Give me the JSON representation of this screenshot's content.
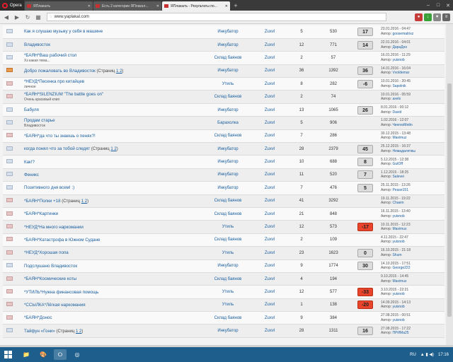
{
  "browser": {
    "menu_label": "Opera",
    "tabs": [
      {
        "label": "ЯПлакалъ",
        "active": false
      },
      {
        "label": "Есть 2 категории ЯПлакал...",
        "active": false
      },
      {
        "label": "ЯПлакалъ - Результаты по...",
        "active": true
      }
    ],
    "new_tab": "+",
    "url": "www.yaplakal.com"
  },
  "topics": [
    {
      "icon": "normal",
      "title": "Как я слушаю музыку у себя в машине",
      "pages": "",
      "subtitle": "",
      "forum": "Инкубатор",
      "author": "Zuxvl",
      "replies": "5",
      "views": "530",
      "rating": "17",
      "rating_type": "pos",
      "last_date": "23.01.2016 - 04:47",
      "last_author_prefix": "Автор:",
      "last_author": "goosematrixz"
    },
    {
      "icon": "normal",
      "title": "Владивосток",
      "pages": "",
      "subtitle": "",
      "forum": "Инкубатор",
      "author": "Zuxvl",
      "replies": "12",
      "views": "771",
      "rating": "14",
      "rating_type": "pos",
      "last_date": "22.01.2016 - 04:01",
      "last_author_prefix": "Автор:",
      "last_author": "ДараДно"
    },
    {
      "icon": "normal",
      "title": "*БАЯН*Ваш рабочий стол",
      "pages": "",
      "subtitle": "Хз какая тема...",
      "forum": "Склад баянов",
      "author": "Zuxvl",
      "replies": "2",
      "views": "57",
      "rating": "",
      "rating_type": "none",
      "last_date": "16.01.2016 - 11:29",
      "last_author_prefix": "Автор:",
      "last_author": "yuisnob"
    },
    {
      "icon": "hot",
      "title": "Добро пожаловать во Владивосток",
      "pages": "1 2",
      "subtitle": "",
      "forum": "Инкубатор",
      "author": "Zuxvl",
      "replies": "36",
      "views": "1392",
      "rating": "36",
      "rating_type": "pos",
      "last_date": "14.01.2016 - 16:04",
      "last_author_prefix": "Автор:",
      "last_author": "Vvoldemar"
    },
    {
      "icon": "red",
      "title": "*НЕУД*Песенка про китайцев",
      "pages": "",
      "subtitle": "личное",
      "forum": "Утиль",
      "author": "Zuxvl",
      "replies": "8",
      "views": "282",
      "rating": "-6",
      "rating_type": "pos",
      "last_date": "10.01.2016 - 20:45",
      "last_author_prefix": "Автор:",
      "last_author": "Sapolnik"
    },
    {
      "icon": "red",
      "title": "*БАЯН*SILENZIUM \"The battle goes on\"",
      "pages": "",
      "subtitle": "Очень красивый клип",
      "forum": "Склад баянов",
      "author": "Zuxvl",
      "replies": "2",
      "views": "74",
      "rating": "",
      "rating_type": "none",
      "last_date": "10.01.2016 - 05:59",
      "last_author_prefix": "Автор:",
      "last_author": "axels"
    },
    {
      "icon": "normal",
      "title": "Бабуля",
      "pages": "",
      "subtitle": "",
      "forum": "Инкубатор",
      "author": "Zuxvl",
      "replies": "13",
      "views": "1065",
      "rating": "26",
      "rating_type": "pos",
      "last_date": "8.01.2016 - 00:12",
      "last_author_prefix": "Автор:",
      "last_author": "David"
    },
    {
      "icon": "normal",
      "title": "Продам старье",
      "pages": "",
      "subtitle": "Владивосток",
      "forum": "Барахолка",
      "author": "Zuxvl",
      "replies": "5",
      "views": "906",
      "rating": "",
      "rating_type": "none",
      "last_date": "1.02.2016 - 12:07",
      "last_author_prefix": "Автор:",
      "last_author": "ЧингизМейо"
    },
    {
      "icon": "red",
      "title": "*БАЯН*да что ты знаешь о пенях?!",
      "pages": "",
      "subtitle": "",
      "forum": "Склад баянов",
      "author": "Zuxvl",
      "replies": "7",
      "views": "286",
      "rating": "",
      "rating_type": "none",
      "last_date": "30.12.2015 - 13:48",
      "last_author_prefix": "Автор:",
      "last_author": "Maximuz"
    },
    {
      "icon": "normal",
      "title": "когда понял что за тобой следят",
      "pages": "1 2",
      "subtitle": "",
      "forum": "Инкубатор",
      "author": "Zuxvl",
      "replies": "28",
      "views": "2379",
      "rating": "45",
      "rating_type": "pos",
      "last_date": "25.12.2015 - 16:37",
      "last_author_prefix": "Автор:",
      "last_author": "Немадалятвы"
    },
    {
      "icon": "normal",
      "title": "Как!?",
      "pages": "",
      "subtitle": "",
      "forum": "Инкубатор",
      "author": "Zuxvl",
      "replies": "10",
      "views": "688",
      "rating": "8",
      "rating_type": "pos",
      "last_date": "5.12.2015 - 12:38",
      "last_author_prefix": "Автор:",
      "last_author": "GutOff"
    },
    {
      "icon": "normal",
      "title": "Феникс",
      "pages": "",
      "subtitle": "",
      "forum": "Инкубатор",
      "author": "Zuxvl",
      "replies": "11",
      "views": "520",
      "rating": "7",
      "rating_type": "pos",
      "last_date": "1.12.2015 - 18:25",
      "last_author_prefix": "Автор:",
      "last_author": "Salevei"
    },
    {
      "icon": "normal",
      "title": "Позитивного дня всем! :)",
      "pages": "",
      "subtitle": "",
      "forum": "Инкубатор",
      "author": "Zuxvl",
      "replies": "7",
      "views": "476",
      "rating": "5",
      "rating_type": "pos",
      "last_date": "25.11.2015 - 13:26",
      "last_author_prefix": "Автор:",
      "last_author": "Pease151"
    },
    {
      "icon": "red",
      "title": "*БАЯН*Полки +18",
      "pages": "1 2",
      "subtitle": "",
      "forum": "Склад баянов",
      "author": "Zuxvl",
      "replies": "41",
      "views": "3292",
      "rating": "",
      "rating_type": "none",
      "last_date": "19.11.2015 - 19:22",
      "last_author_prefix": "Автор:",
      "last_author": "Chaem"
    },
    {
      "icon": "red",
      "title": "*БАЯН*Картинки",
      "pages": "",
      "subtitle": "",
      "forum": "Склад баянов",
      "author": "Zuxvl",
      "replies": "21",
      "views": "848",
      "rating": "",
      "rating_type": "none",
      "last_date": "16.11.2015 - 13:40",
      "last_author_prefix": "Автор:",
      "last_author": "yuisnob"
    },
    {
      "icon": "red",
      "title": "*НЕУД*На много наркомании",
      "pages": "",
      "subtitle": "",
      "forum": "Утиль",
      "author": "Zuxvl",
      "replies": "12",
      "views": "573",
      "rating": "-17",
      "rating_type": "neg",
      "last_date": "10.11.2015 - 12:23",
      "last_author_prefix": "Автор:",
      "last_author": "Maximus"
    },
    {
      "icon": "red",
      "title": "*БАЯН*Катастрофа в Южном Судане",
      "pages": "",
      "subtitle": "",
      "forum": "Склад баянов",
      "author": "Zuxvl",
      "replies": "2",
      "views": "109",
      "rating": "",
      "rating_type": "none",
      "last_date": "4.11.2015 - 22:47",
      "last_author_prefix": "Автор:",
      "last_author": "yuisnob"
    },
    {
      "icon": "red",
      "title": "*НЕУД*Хорошая попа",
      "pages": "",
      "subtitle": "",
      "forum": "Утиль",
      "author": "Zuxvl",
      "replies": "23",
      "views": "1623",
      "rating": "0",
      "rating_type": "pos",
      "last_date": "16.10.2015 - 21:18",
      "last_author_prefix": "Автор:",
      "last_author": "Shum"
    },
    {
      "icon": "normal",
      "title": "Подслушано Владивосток",
      "pages": "",
      "subtitle": "",
      "forum": "Инкубатор",
      "author": "Zuxvl",
      "replies": "9",
      "views": "1774",
      "rating": "30",
      "rating_type": "pos",
      "last_date": "14.10.2015 - 17:51",
      "last_author_prefix": "Автор:",
      "last_author": "George222"
    },
    {
      "icon": "red",
      "title": "*БАЯН*Космические коты",
      "pages": "",
      "subtitle": "",
      "forum": "Склад баянов",
      "author": "Zuxvl",
      "replies": "4",
      "views": "194",
      "rating": "",
      "rating_type": "none",
      "last_date": "9.10.2015 - 14:45",
      "last_author_prefix": "Автор:",
      "last_author": "Maximuz"
    },
    {
      "icon": "red",
      "title": "*УТИЛЬ*Нужна финансовая помощь",
      "pages": "",
      "subtitle": "",
      "forum": "Утиль",
      "author": "Zuxvl",
      "replies": "12",
      "views": "577",
      "rating": "-33",
      "rating_type": "neg",
      "last_date": "3.10.2015 - 22:21",
      "last_author_prefix": "Автор:",
      "last_author": "yuisnob"
    },
    {
      "icon": "red",
      "title": "*ССЫЛКА*Лёгкая наркомания",
      "pages": "",
      "subtitle": "",
      "forum": "Утиль",
      "author": "Zuxvl",
      "replies": "1",
      "views": "138",
      "rating": "-20",
      "rating_type": "neg",
      "last_date": "14.09.2015 - 14:13",
      "last_author_prefix": "Автор:",
      "last_author": "yuisnob"
    },
    {
      "icon": "red",
      "title": "*БАЯН*Донос",
      "pages": "",
      "subtitle": "",
      "forum": "Склад баянов",
      "author": "Zuxvl",
      "replies": "9",
      "views": "384",
      "rating": "",
      "rating_type": "none",
      "last_date": "27.08.2015 - 00:51",
      "last_author_prefix": "Автор:",
      "last_author": "yuisnob"
    },
    {
      "icon": "normal",
      "title": "Тайфун «Гони»",
      "pages": "1 2",
      "subtitle": "",
      "forum": "Инкубатор",
      "author": "Zuxvl",
      "replies": "28",
      "views": "1311",
      "rating": "16",
      "rating_type": "pos",
      "last_date": "27.08.2015 - 17:22",
      "last_author_prefix": "Автор:",
      "last_author": "ПРИМа25"
    }
  ],
  "pages_prefix": "(Страниц",
  "pages_suffix": ")",
  "taskbar": {
    "lang": "RU",
    "time": "17:16"
  },
  "colors": {
    "link": "#1a5fa0",
    "negative_rating": "#e8452c",
    "taskbar": "#1d5e8c"
  }
}
